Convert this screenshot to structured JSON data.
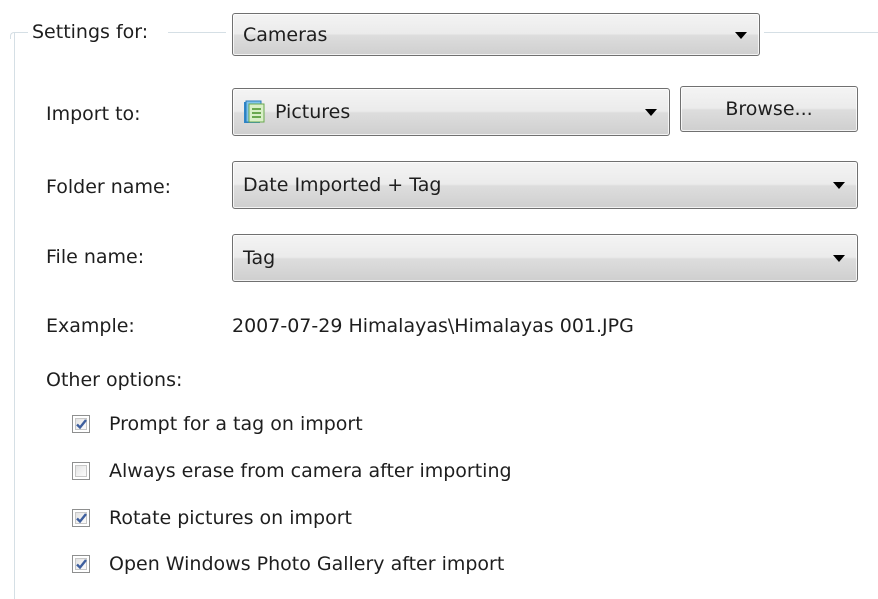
{
  "settings_for": {
    "label": "Settings for:",
    "value": "Cameras"
  },
  "import_to": {
    "label": "Import to:",
    "value": "Pictures",
    "icon": "pictures-library-icon",
    "browse_label": "Browse..."
  },
  "folder_name": {
    "label": "Folder name:",
    "value": "Date Imported + Tag"
  },
  "file_name": {
    "label": "File name:",
    "value": "Tag"
  },
  "example": {
    "label": "Example:",
    "value": "2007-07-29 Himalayas\\Himalayas 001.JPG"
  },
  "other_options": {
    "label": "Other options:",
    "items": [
      {
        "label": "Prompt for a tag on import",
        "checked": true
      },
      {
        "label": "Always erase from camera after importing",
        "checked": false
      },
      {
        "label": "Rotate pictures on import",
        "checked": true
      },
      {
        "label": "Open Windows Photo Gallery after import",
        "checked": true
      }
    ]
  },
  "colors": {
    "frame": "#d5dfe5",
    "check_mark": "#3e5f9e",
    "control_border": "#707070"
  }
}
